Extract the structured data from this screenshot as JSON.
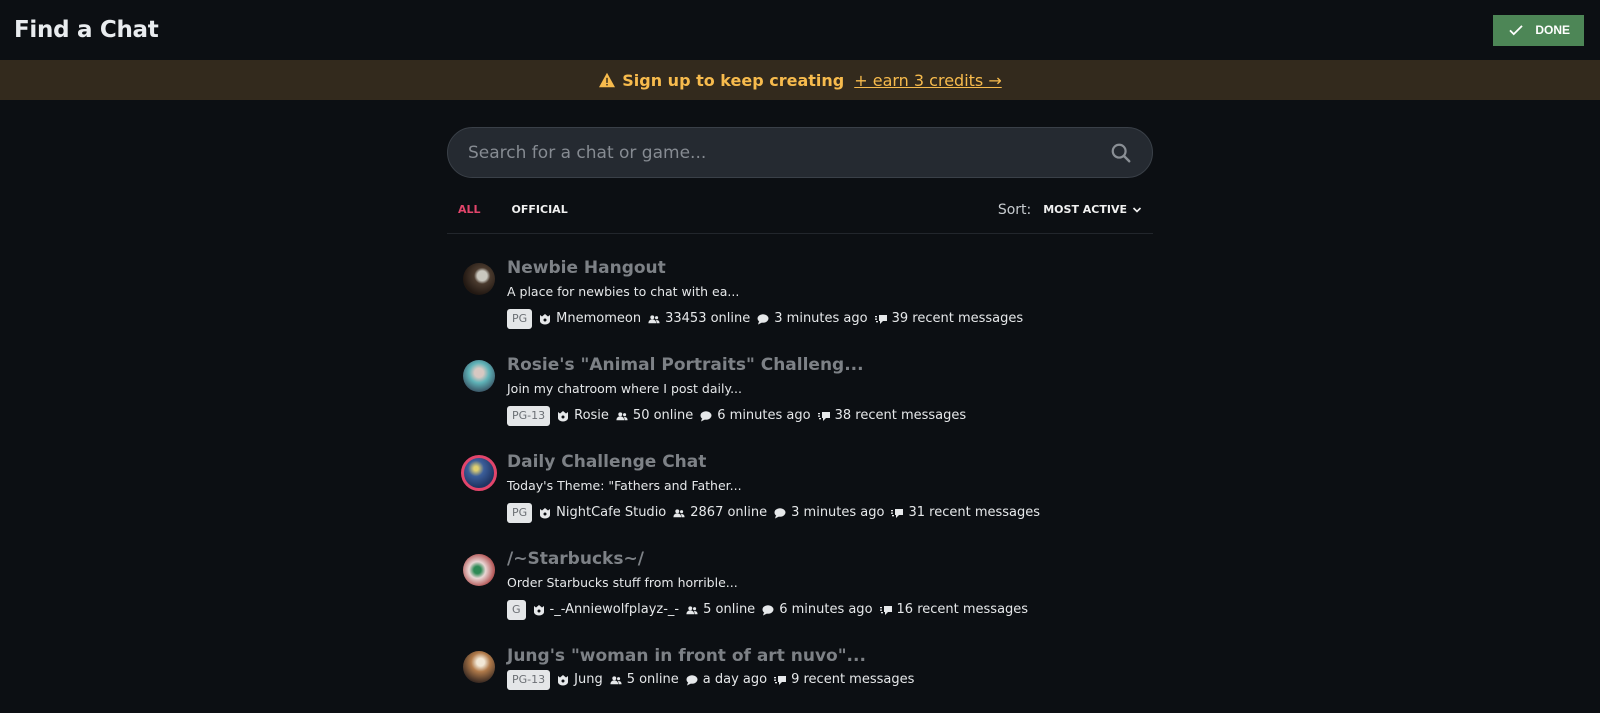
{
  "header": {
    "title": "Find a Chat",
    "done_label": "DONE"
  },
  "banner": {
    "text": "Sign up to keep creating",
    "link": "+ earn 3 credits →",
    "color": "#f7bb4d"
  },
  "search": {
    "placeholder": "Search for a chat or game..."
  },
  "filters": {
    "tabs": [
      {
        "label": "ALL",
        "active": true
      },
      {
        "label": "OFFICIAL",
        "active": false
      }
    ],
    "sort_label": "Sort:",
    "sort_value": "MOST ACTIVE"
  },
  "chats": [
    {
      "name": "Newbie Hangout",
      "description": "A place for newbies to chat with ea...",
      "rating": "PG",
      "owner": "Mnemomeon",
      "online": "33453 online",
      "last_active": "3 minutes ago",
      "messages": "39 recent messages"
    },
    {
      "name": "Rosie's \"Animal Portraits\" Challeng...",
      "description": "Join my chatroom where I post daily...",
      "rating": "PG-13",
      "owner": "Rosie",
      "online": "50 online",
      "last_active": "6 minutes ago",
      "messages": "38 recent messages"
    },
    {
      "name": "Daily Challenge Chat",
      "description": "Today's Theme: \"Fathers and Father...",
      "rating": "PG",
      "owner": "NightCafe Studio",
      "online": "2867 online",
      "last_active": "3 minutes ago",
      "messages": "31 recent messages"
    },
    {
      "name": "/~Starbucks~/",
      "description": "Order Starbucks stuff from horrible...",
      "rating": "G",
      "owner": "-_-Anniewolfplayz-_-",
      "online": "5 online",
      "last_active": "6 minutes ago",
      "messages": "16 recent messages"
    },
    {
      "name": "Jung's \"woman in front of art nuvo\"...",
      "description": "",
      "rating": "PG-13",
      "owner": "Jung",
      "online": "5 online",
      "last_active": "a day ago",
      "messages": "9 recent messages"
    }
  ],
  "colors": {
    "accent": "#e2456b",
    "done_green": "#4d8656",
    "banner_bg": "#332a1d"
  }
}
